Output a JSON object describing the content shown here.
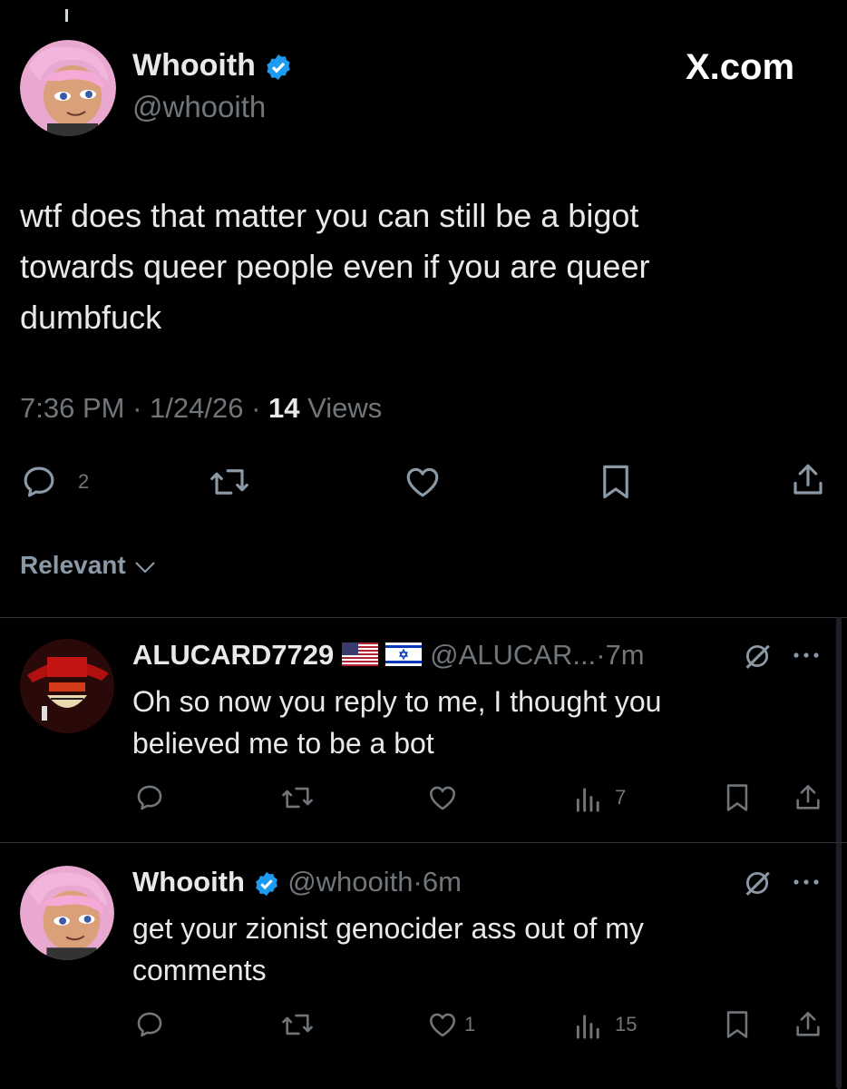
{
  "main_tweet": {
    "display_name": "Whooith",
    "handle": "@whooith",
    "site_label": "X.com",
    "text_lines": [
      "wtf does that matter you can still be a bigot",
      "towards queer people even if you are queer",
      "dumbfuck"
    ],
    "time": "7:36 PM",
    "date": "1/24/26",
    "views_count": "14",
    "views_label": "Views",
    "reply_count": "2"
  },
  "sort": {
    "label": "Relevant"
  },
  "replies": [
    {
      "display_name": "ALUCARD7729",
      "handle": "@ALUCAR...",
      "time": "7m",
      "text_lines": [
        "Oh so now you reply to me, I thought you",
        "believed me to be a bot"
      ],
      "views": "7",
      "likes": ""
    },
    {
      "display_name": "Whooith",
      "handle": "@whooith",
      "time": "6m",
      "text_lines": [
        "get your zionist genocider ass out of my",
        "comments"
      ],
      "views": "15",
      "likes": "1"
    }
  ],
  "separator": "·",
  "colors": {
    "background": "#000000",
    "text": "#e7e9ea",
    "muted": "#71767b",
    "verified": "#1d9bf0",
    "divider": "#2f3336"
  },
  "icons": [
    "verified-badge-icon",
    "reply-icon",
    "retweet-icon",
    "like-icon",
    "bookmark-icon",
    "share-icon",
    "views-icon",
    "grok-icon",
    "more-icon",
    "chevron-down-icon",
    "us-flag-icon",
    "israel-flag-icon"
  ]
}
